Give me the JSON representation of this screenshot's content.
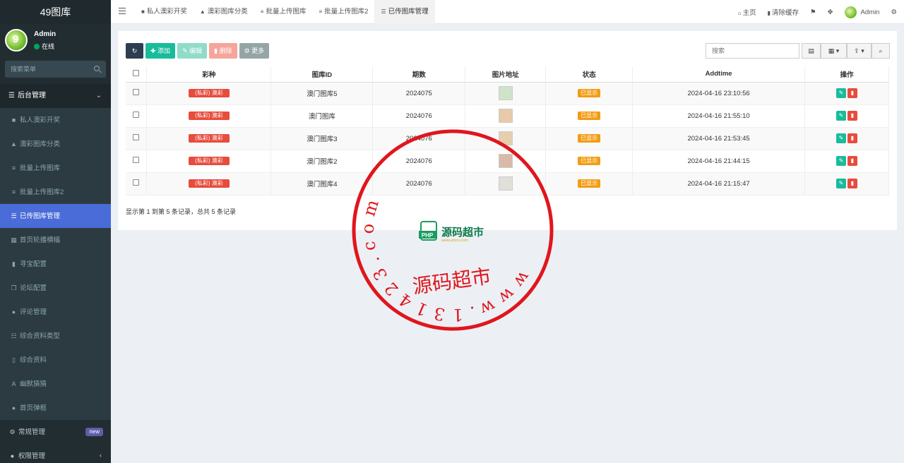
{
  "sidebar": {
    "logo": "49图库",
    "user": {
      "name": "Admin",
      "status": "在线"
    },
    "search_placeholder": "搜索菜单",
    "menu_header": "后台管理",
    "items": [
      {
        "label": "私人澳彩开奖",
        "icon": "briefcase-icon",
        "glyph": "■"
      },
      {
        "label": "澳彩图库分类",
        "icon": "bell-icon",
        "glyph": "▲"
      },
      {
        "label": "批量上传图库",
        "icon": "database-icon",
        "glyph": "≡"
      },
      {
        "label": "批量上传图库2",
        "icon": "database-icon",
        "glyph": "≡"
      },
      {
        "label": "已传图库管理",
        "icon": "list-icon",
        "glyph": "☰"
      },
      {
        "label": "首页轮播横幅",
        "icon": "windows-icon",
        "glyph": "▦"
      },
      {
        "label": "寻宝配置",
        "icon": "signal-icon",
        "glyph": "▮"
      },
      {
        "label": "论坛配置",
        "icon": "clone-icon",
        "glyph": "❐"
      },
      {
        "label": "评论管理",
        "icon": "comments-icon",
        "glyph": "●"
      },
      {
        "label": "综合资料类型",
        "icon": "list-ul-icon",
        "glyph": "☷"
      },
      {
        "label": "综合资料",
        "icon": "file-icon",
        "glyph": "▯"
      },
      {
        "label": "幽默猜猜",
        "icon": "language-icon",
        "glyph": "A"
      },
      {
        "label": "首页弹框",
        "icon": "comment-icon",
        "glyph": "●"
      }
    ],
    "general": {
      "label": "常规管理",
      "badge": "new"
    },
    "permission": {
      "label": "权限管理"
    }
  },
  "topbar": {
    "tabs": [
      {
        "label": "私人澳彩开奖",
        "icon": "briefcase-icon"
      },
      {
        "label": "澳彩图库分类",
        "icon": "bell-icon"
      },
      {
        "label": "批量上传图库",
        "icon": "database-icon"
      },
      {
        "label": "批量上传图库2",
        "icon": "database-icon"
      },
      {
        "label": "已传图库管理",
        "icon": "list-icon"
      }
    ],
    "home": "主页",
    "clear_cache": "清除缓存",
    "admin": "Admin"
  },
  "toolbar": {
    "add": "添加",
    "edit": "编辑",
    "delete": "删除",
    "more": "更多",
    "search_placeholder": "搜索"
  },
  "table": {
    "columns": [
      "彩种",
      "图库ID",
      "期数",
      "图片地址",
      "状态",
      "Addtime",
      "操作"
    ],
    "rows": [
      {
        "category": "(私彩) 澳彩",
        "gallery_id": "澳门图库5",
        "period": "2024075",
        "status": "已显示",
        "addtime": "2024-04-16 23:10:56"
      },
      {
        "category": "(私彩) 澳彩",
        "gallery_id": "澳门图库",
        "period": "2024076",
        "status": "已显示",
        "addtime": "2024-04-16 21:55:10"
      },
      {
        "category": "(私彩) 澳彩",
        "gallery_id": "澳门图库3",
        "period": "2024076",
        "status": "已显示",
        "addtime": "2024-04-16 21:53:45"
      },
      {
        "category": "(私彩) 澳彩",
        "gallery_id": "澳门图库2",
        "period": "2024076",
        "status": "已显示",
        "addtime": "2024-04-16 21:44:15"
      },
      {
        "category": "(私彩) 澳彩",
        "gallery_id": "澳门图库4",
        "period": "2024076",
        "status": "已显示",
        "addtime": "2024-04-16 21:15:47"
      }
    ]
  },
  "pager_info": "显示第 1 到第 5 条记录，总共 5 条记录",
  "watermark": {
    "ring_text": "www.131423.com",
    "bottom_text": "源码超市",
    "logo_text": "源码超市",
    "logo_sub": "www.ymcs.com",
    "logo_badge": "PHP"
  },
  "colors": {
    "sidebar": "#222d32",
    "active": "#4a6cd8",
    "success": "#18bc9c",
    "danger": "#e74c3c",
    "warning": "#f39c12",
    "stamp": "#e0161d"
  }
}
